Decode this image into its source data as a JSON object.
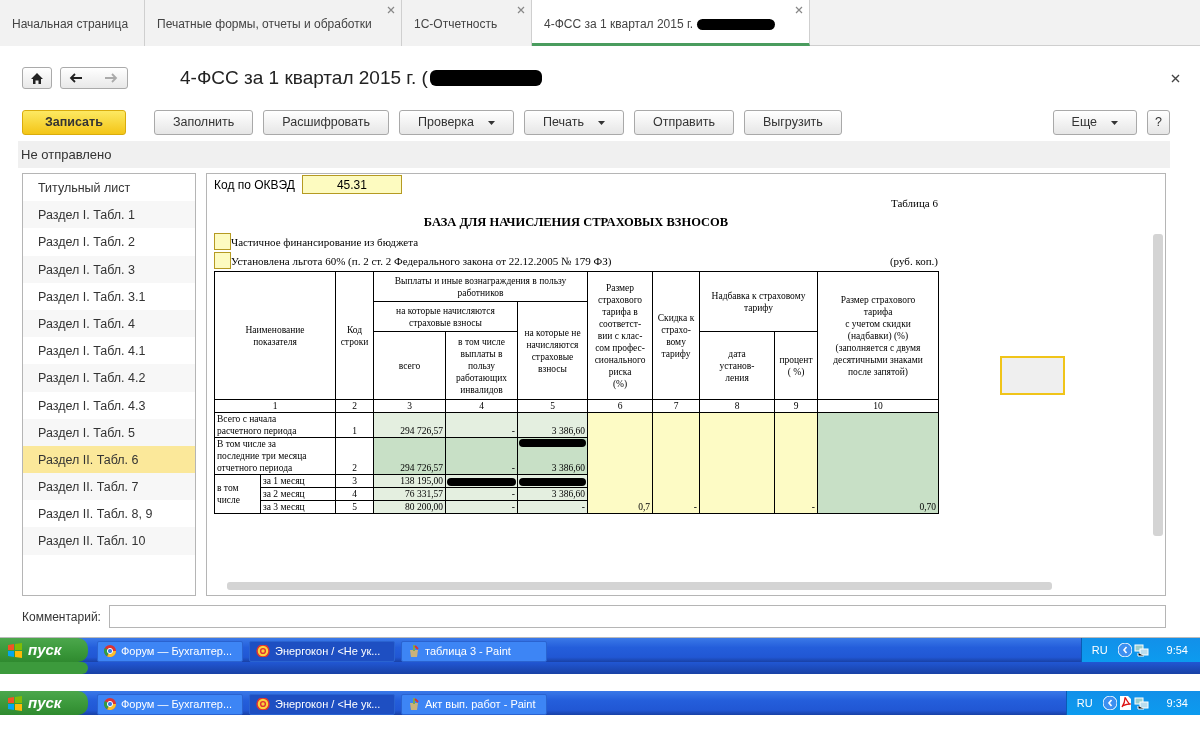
{
  "tabs": [
    {
      "label": "Начальная страница",
      "selected": false,
      "closable": false
    },
    {
      "label": "Печатные формы, отчеты и обработки",
      "selected": false,
      "closable": true
    },
    {
      "label": "1С-Отчетность",
      "selected": false,
      "closable": true
    },
    {
      "label": "4-ФСС за 1 квартал 2015 г.",
      "selected": true,
      "closable": true,
      "redacted": true
    }
  ],
  "form": {
    "title": "4-ФСС за 1 квартал 2015 г. (",
    "title_redacted": true,
    "back": {
      "disabled": false
    },
    "forward": {
      "disabled": true
    },
    "toolbar": [
      {
        "label": "Записать",
        "kind": "primary"
      },
      {
        "label": "Заполнить",
        "kind": "button"
      },
      {
        "label": "Расшифровать",
        "kind": "button"
      },
      {
        "label": "Проверка",
        "kind": "dropdown"
      },
      {
        "label": "Печать",
        "kind": "dropdown"
      },
      {
        "label": "Отправить",
        "kind": "button"
      },
      {
        "label": "Выгрузить",
        "kind": "button"
      }
    ],
    "more_button": {
      "label": "Еще",
      "kind": "dropdown"
    },
    "help_button": {
      "label": "?"
    },
    "status": "Не отправлено"
  },
  "sidebar": {
    "items": [
      {
        "label": "Титульный лист",
        "selected": false
      },
      {
        "label": "Раздел I. Табл. 1",
        "selected": false
      },
      {
        "label": "Раздел I. Табл. 2",
        "selected": false
      },
      {
        "label": "Раздел I. Табл. 3",
        "selected": false
      },
      {
        "label": "Раздел I. Табл. 3.1",
        "selected": false
      },
      {
        "label": "Раздел I. Табл. 4",
        "selected": false
      },
      {
        "label": "Раздел I. Табл. 4.1",
        "selected": false
      },
      {
        "label": "Раздел I. Табл. 4.2",
        "selected": false
      },
      {
        "label": "Раздел I. Табл. 4.3",
        "selected": false
      },
      {
        "label": "Раздел I. Табл. 5",
        "selected": false
      },
      {
        "label": "Раздел II. Табл. 6",
        "selected": true
      },
      {
        "label": "Раздел II. Табл. 7",
        "selected": false
      },
      {
        "label": "Раздел II. Табл. 8, 9",
        "selected": false
      },
      {
        "label": "Раздел II. Табл. 10",
        "selected": false
      }
    ]
  },
  "document": {
    "okved_label": "Код по ОКВЭД",
    "okved_value": "45.31",
    "table_number": "Таблица 6",
    "heading": "БАЗА ДЛЯ НАЧИСЛЕНИЯ СТРАХОВЫХ ВЗНОСОВ",
    "flags": [
      {
        "label": "Частичное финансирование из бюджета",
        "checked": false
      },
      {
        "label": "Установлена льгота 60% (п. 2 ст. 2 Федерального закона от 22.12.2005 № 179 ФЗ)",
        "checked": false
      }
    ],
    "units": "(руб. коп.)",
    "table": {
      "header_cells": [
        "Наименование\nпоказателя",
        "Код\nстроки",
        "Выплаты и иные вознаграждения в пользу\nработников",
        "Размер\nстрахового\nтарифа в\nсоответст-\nвии с клас-\nсом профес-\nсионального\nриска\n(%)",
        "Скидка к\nстрахо-\nвому\nтарифу",
        "Надбавка к страховому\nтарифу",
        "Размер страхового\nтарифа\nс учетом скидки\n(надбавки) (%)\n(заполняется с двумя\nдесятичными знаками\nпосле запятой)",
        "на которые начисляются\nстраховые взносы",
        "всего",
        "в том числе\nвыплаты в\nпользу\nработающих\nинвалидов",
        "на которые не\nначисляются\nстраховые\nвзносы",
        "дата\nустанов-\nления",
        "процент\n( %)"
      ],
      "column_numbers": [
        "1",
        "2",
        "3",
        "4",
        "5",
        "6",
        "7",
        "8",
        "9",
        "10"
      ],
      "rows": [
        {
          "kind": "row",
          "label": "Всего с начала\nрасчетного  периода",
          "code": "1",
          "cells": [
            {
              "value": "294 726,57",
              "kind": "input"
            },
            {
              "value": "-",
              "kind": "input"
            },
            {
              "value": "3 386,60",
              "kind": "input"
            }
          ]
        },
        {
          "kind": "row",
          "label": "В том числе за\nпоследние три месяца\nотчетного периода",
          "code": "2",
          "cells": [
            {
              "value": "294 726,57",
              "kind": "total"
            },
            {
              "value": "-",
              "kind": "total"
            },
            {
              "value": "3 386,60",
              "kind": "total",
              "redacted": true
            }
          ]
        },
        {
          "kind": "group",
          "label": "в том\nчисле",
          "children": [
            {
              "label": "за 1 месяц",
              "code": "3",
              "cells": [
                {
                  "value": "138 195,00",
                  "kind": "input"
                },
                {
                  "kind": "input",
                  "redacted": true
                },
                {
                  "kind": "input",
                  "redacted": true
                }
              ]
            },
            {
              "label": "за 2 месяц",
              "code": "4",
              "cells": [
                {
                  "value": "76 331,57",
                  "kind": "input"
                },
                {
                  "value": "-",
                  "kind": "input"
                },
                {
                  "value": "3 386,60",
                  "kind": "input"
                }
              ]
            },
            {
              "label": "за 3 месяц",
              "code": "5",
              "cells": [
                {
                  "value": "80 200,00",
                  "kind": "input"
                },
                {
                  "value": "-",
                  "kind": "input"
                },
                {
                  "value": "-",
                  "kind": "input"
                }
              ]
            }
          ]
        }
      ],
      "tariff_columns": [
        {
          "value": "0,7",
          "kind": "manual"
        },
        {
          "value": "-",
          "kind": "manual"
        },
        {
          "kind": "manual"
        },
        {
          "value": "-",
          "kind": "manual"
        },
        {
          "value": "0,70",
          "kind": "computed"
        }
      ]
    }
  },
  "comment": {
    "label": "Комментарий:"
  },
  "taskbars": [
    {
      "start": "пуск",
      "tasks": [
        {
          "label": "Форум — Бухгалтер...",
          "kind": "browser",
          "selected": false
        },
        {
          "label": "Энергокон / <Не ук...",
          "kind": "ledger",
          "selected": true
        },
        {
          "label": "таблица 3 - Paint",
          "kind": "paint",
          "selected": false
        }
      ],
      "language": "RU",
      "tray": [
        {
          "kind": "expand"
        },
        {
          "kind": "network"
        }
      ],
      "time": "9:54"
    },
    {
      "start": "пуск",
      "tasks": [
        {
          "label": "Форум — Бухгалтер...",
          "kind": "browser",
          "selected": false
        },
        {
          "label": "Энергокон / <Не ук...",
          "kind": "ledger",
          "selected": true
        },
        {
          "label": "Акт вып. работ - Paint",
          "kind": "paint",
          "selected": false
        }
      ],
      "language": "RU",
      "tray": [
        {
          "kind": "expand"
        },
        {
          "kind": "document"
        },
        {
          "kind": "network"
        }
      ],
      "time": "9:34"
    }
  ]
}
